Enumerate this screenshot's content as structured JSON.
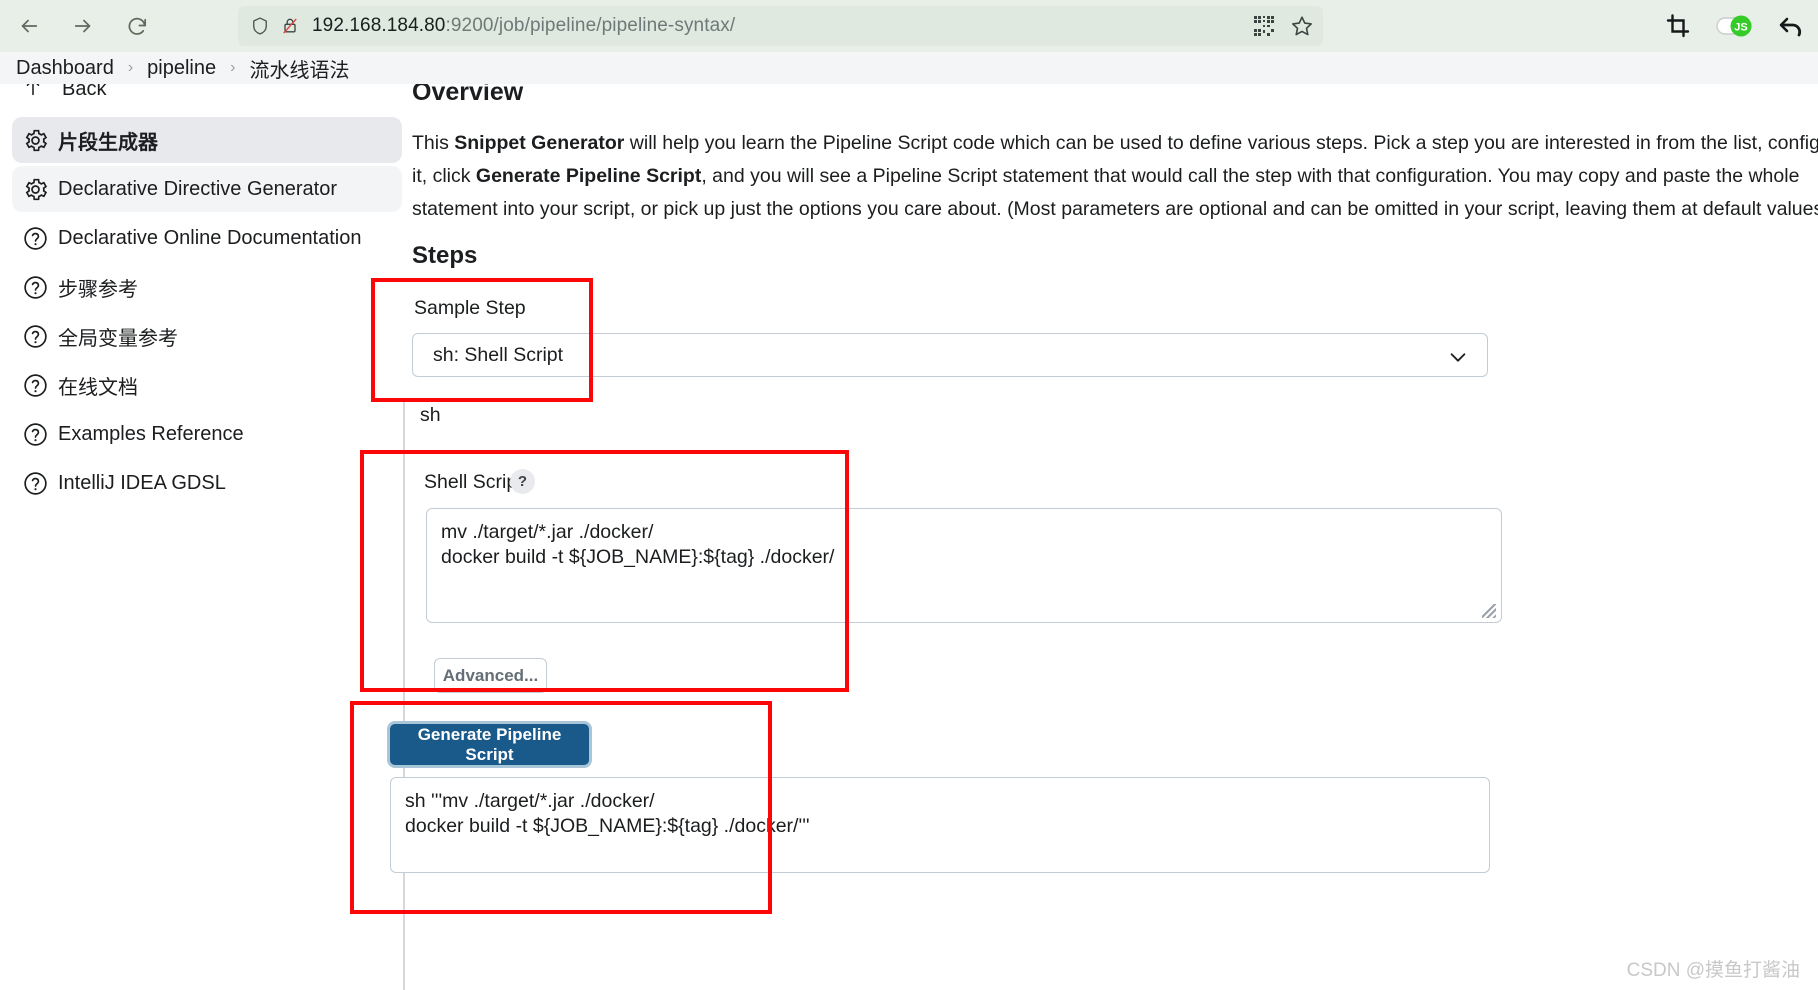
{
  "browser": {
    "back_icon": "arrow-left-icon",
    "forward_icon": "arrow-right-icon",
    "reload_icon": "reload-icon",
    "url_host": "192.168.184.80",
    "url_port": ":9200",
    "url_path": "/job/pipeline/pipeline-syntax/",
    "shield_icon": "shield-icon",
    "insecure_icon": "lock-crossed-icon",
    "qr_icon": "qr-code-icon",
    "bookmark_icon": "star-icon",
    "crop_icon": "crop-icon",
    "js_toggle_icon": "js-toggle-icon",
    "js_toggle_label": "JS",
    "undo_icon": "undo-arrow-icon"
  },
  "breadcrumb": {
    "items": [
      {
        "label": "Dashboard"
      },
      {
        "label": "pipeline"
      },
      {
        "label": "流水线语法"
      }
    ],
    "separator": "›"
  },
  "sidebar": {
    "back_label": "Back",
    "back_icon": "arrow-up-icon",
    "items": [
      {
        "label": "片段生成器",
        "icon": "gear-icon",
        "state": "active"
      },
      {
        "label": "Declarative Directive Generator",
        "icon": "gear-icon",
        "state": "hover"
      },
      {
        "label": "Declarative Online Documentation",
        "icon": "question-circle-icon",
        "state": "normal"
      },
      {
        "label": "步骤参考",
        "icon": "question-circle-icon",
        "state": "normal"
      },
      {
        "label": "全局变量参考",
        "icon": "question-circle-icon",
        "state": "normal"
      },
      {
        "label": "在线文档",
        "icon": "question-circle-icon",
        "state": "normal"
      },
      {
        "label": "Examples Reference",
        "icon": "question-circle-icon",
        "state": "normal"
      },
      {
        "label": "IntelliJ IDEA GDSL",
        "icon": "question-circle-icon",
        "state": "normal"
      }
    ]
  },
  "main": {
    "overview_title": "Overview",
    "overview_paragraph": {
      "p1": "This ",
      "b1": "Snippet Generator",
      "p2": " will help you learn the Pipeline Script code which can be used to define various steps. Pick a step you are interested in from the list, configure it, click ",
      "b2": "Generate Pipeline Script",
      "p3": ", and you will see a Pipeline Script statement that would call the step with that configuration. You may copy and paste the whole statement into your script, or pick up just the options you care about. (Most parameters are optional and can be omitted in your script, leaving them at default values.)"
    },
    "steps_title": "Steps",
    "sample_step_label": "Sample Step",
    "sample_step_value": "sh: Shell Script",
    "sample_step_chevron": "chevron-down-icon",
    "tree_tag": "sh",
    "shell_script_label": "Shell Script",
    "shell_help_glyph": "?",
    "shell_script_value": "mv ./target/*.jar ./docker/\ndocker build -t ${JOB_NAME}:${tag} ./docker/",
    "advanced_label": "Advanced...",
    "generate_label": "Generate Pipeline Script",
    "generated_script": "sh '''mv ./target/*.jar ./docker/\ndocker build -t ${JOB_NAME}:${tag} ./docker/'''"
  },
  "annotations": {
    "accent_color": "#fb0707",
    "boxes": [
      {
        "name": "sample-step-highlight"
      },
      {
        "name": "shell-script-highlight"
      },
      {
        "name": "generate-script-highlight"
      }
    ]
  },
  "watermark": {
    "text": "CSDN @摸鱼打酱油"
  }
}
